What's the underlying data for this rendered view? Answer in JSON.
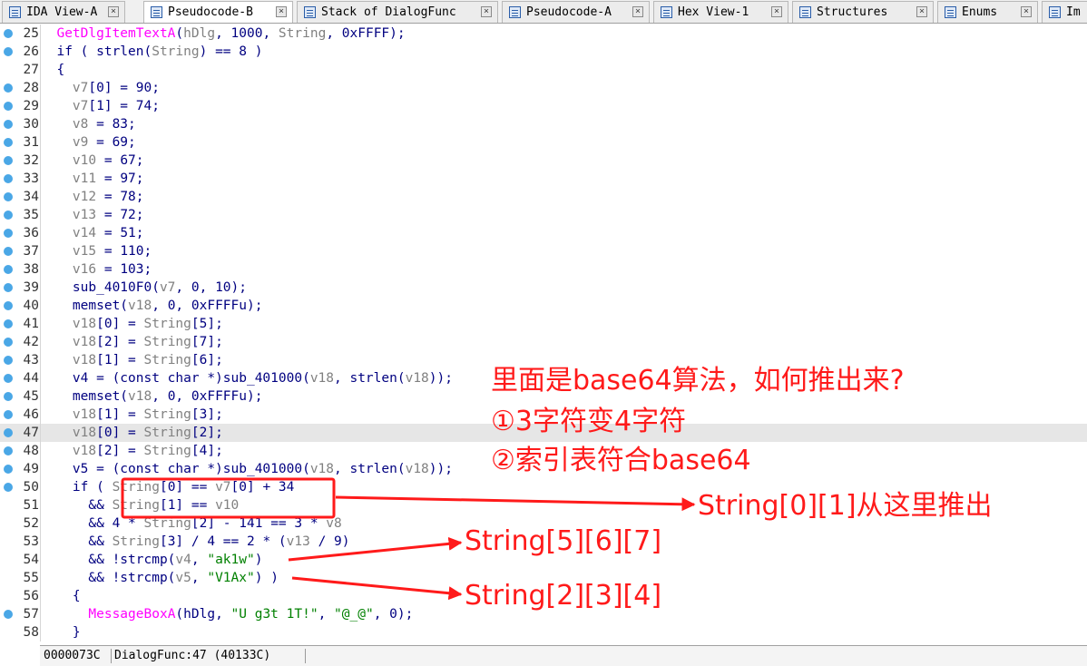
{
  "tabs": [
    {
      "label": "IDA View-A",
      "close": "×",
      "icon": "ida-view-icon",
      "active": false
    },
    {
      "label": "Pseudocode-B",
      "close": "×",
      "icon": "pseudocode-icon",
      "active": true
    },
    {
      "label": "Stack of DialogFunc",
      "close": "×",
      "icon": "stack-icon",
      "active": false
    },
    {
      "label": "Pseudocode-A",
      "close": "×",
      "icon": "pseudocode-icon",
      "active": false
    },
    {
      "label": "Hex View-1",
      "close": "×",
      "icon": "hex-view-icon",
      "active": false
    },
    {
      "label": "Structures",
      "close": "×",
      "icon": "structures-icon",
      "active": false
    },
    {
      "label": "Enums",
      "close": "×",
      "icon": "enums-icon",
      "active": false
    },
    {
      "label": "Im",
      "close": "",
      "icon": "imports-icon",
      "active": false
    }
  ],
  "code_lines": [
    {
      "num": "25",
      "bp": true,
      "segs": [
        {
          "c": "  "
        },
        {
          "c": "GetDlgItemTextA",
          "t": "fn"
        },
        {
          "c": "("
        },
        {
          "c": "hDlg",
          "t": "var"
        },
        {
          "c": ", 1000, "
        },
        {
          "c": "String",
          "t": "var"
        },
        {
          "c": ", 0xFFFF);"
        }
      ]
    },
    {
      "num": "26",
      "bp": true,
      "segs": [
        {
          "c": "  if ( strlen("
        },
        {
          "c": "String",
          "t": "var"
        },
        {
          "c": ") == 8 )"
        }
      ]
    },
    {
      "num": "27",
      "bp": false,
      "segs": [
        {
          "c": "  {"
        }
      ]
    },
    {
      "num": "28",
      "bp": true,
      "segs": [
        {
          "c": "    "
        },
        {
          "c": "v7",
          "t": "var"
        },
        {
          "c": "[0] = 90;"
        }
      ]
    },
    {
      "num": "29",
      "bp": true,
      "segs": [
        {
          "c": "    "
        },
        {
          "c": "v7",
          "t": "var"
        },
        {
          "c": "[1] = 74;"
        }
      ]
    },
    {
      "num": "30",
      "bp": true,
      "segs": [
        {
          "c": "    "
        },
        {
          "c": "v8",
          "t": "var"
        },
        {
          "c": " = 83;"
        }
      ]
    },
    {
      "num": "31",
      "bp": true,
      "segs": [
        {
          "c": "    "
        },
        {
          "c": "v9",
          "t": "var"
        },
        {
          "c": " = 69;"
        }
      ]
    },
    {
      "num": "32",
      "bp": true,
      "segs": [
        {
          "c": "    "
        },
        {
          "c": "v10",
          "t": "var"
        },
        {
          "c": " = 67;"
        }
      ]
    },
    {
      "num": "33",
      "bp": true,
      "segs": [
        {
          "c": "    "
        },
        {
          "c": "v11",
          "t": "var"
        },
        {
          "c": " = 97;"
        }
      ]
    },
    {
      "num": "34",
      "bp": true,
      "segs": [
        {
          "c": "    "
        },
        {
          "c": "v12",
          "t": "var"
        },
        {
          "c": " = 78;"
        }
      ]
    },
    {
      "num": "35",
      "bp": true,
      "segs": [
        {
          "c": "    "
        },
        {
          "c": "v13",
          "t": "var"
        },
        {
          "c": " = 72;"
        }
      ]
    },
    {
      "num": "36",
      "bp": true,
      "segs": [
        {
          "c": "    "
        },
        {
          "c": "v14",
          "t": "var"
        },
        {
          "c": " = 51;"
        }
      ]
    },
    {
      "num": "37",
      "bp": true,
      "segs": [
        {
          "c": "    "
        },
        {
          "c": "v15",
          "t": "var"
        },
        {
          "c": " = 110;"
        }
      ]
    },
    {
      "num": "38",
      "bp": true,
      "segs": [
        {
          "c": "    "
        },
        {
          "c": "v16",
          "t": "var"
        },
        {
          "c": " = 103;"
        }
      ]
    },
    {
      "num": "39",
      "bp": true,
      "segs": [
        {
          "c": "    sub_4010F0("
        },
        {
          "c": "v7",
          "t": "var"
        },
        {
          "c": ", 0, 10);"
        }
      ]
    },
    {
      "num": "40",
      "bp": true,
      "segs": [
        {
          "c": "    memset("
        },
        {
          "c": "v18",
          "t": "var"
        },
        {
          "c": ", 0, 0xFFFFu);"
        }
      ]
    },
    {
      "num": "41",
      "bp": true,
      "segs": [
        {
          "c": "    "
        },
        {
          "c": "v18",
          "t": "var"
        },
        {
          "c": "[0] = "
        },
        {
          "c": "String",
          "t": "var"
        },
        {
          "c": "[5];"
        }
      ]
    },
    {
      "num": "42",
      "bp": true,
      "segs": [
        {
          "c": "    "
        },
        {
          "c": "v18",
          "t": "var"
        },
        {
          "c": "[2] = "
        },
        {
          "c": "String",
          "t": "var"
        },
        {
          "c": "[7];"
        }
      ]
    },
    {
      "num": "43",
      "bp": true,
      "segs": [
        {
          "c": "    "
        },
        {
          "c": "v18",
          "t": "var"
        },
        {
          "c": "[1] = "
        },
        {
          "c": "String",
          "t": "var"
        },
        {
          "c": "[6];"
        }
      ]
    },
    {
      "num": "44",
      "bp": true,
      "segs": [
        {
          "c": "    v4 = (const char *)sub_401000("
        },
        {
          "c": "v18",
          "t": "var"
        },
        {
          "c": ", strlen("
        },
        {
          "c": "v18",
          "t": "var"
        },
        {
          "c": "));"
        }
      ]
    },
    {
      "num": "45",
      "bp": true,
      "segs": [
        {
          "c": "    memset("
        },
        {
          "c": "v18",
          "t": "var"
        },
        {
          "c": ", 0, 0xFFFFu);"
        }
      ]
    },
    {
      "num": "46",
      "bp": true,
      "segs": [
        {
          "c": "    "
        },
        {
          "c": "v18",
          "t": "var"
        },
        {
          "c": "[1] = "
        },
        {
          "c": "String",
          "t": "var"
        },
        {
          "c": "[3];"
        }
      ]
    },
    {
      "num": "47",
      "bp": true,
      "hl": true,
      "segs": [
        {
          "c": "    "
        },
        {
          "c": "v18",
          "t": "var"
        },
        {
          "c": "[0] = "
        },
        {
          "c": "String",
          "t": "var"
        },
        {
          "c": "[2];"
        }
      ]
    },
    {
      "num": "48",
      "bp": true,
      "segs": [
        {
          "c": "    "
        },
        {
          "c": "v18",
          "t": "var"
        },
        {
          "c": "[2] = "
        },
        {
          "c": "String",
          "t": "var"
        },
        {
          "c": "[4];"
        }
      ]
    },
    {
      "num": "49",
      "bp": true,
      "segs": [
        {
          "c": "    v5 = (const char *)sub_401000("
        },
        {
          "c": "v18",
          "t": "var"
        },
        {
          "c": ", strlen("
        },
        {
          "c": "v18",
          "t": "var"
        },
        {
          "c": "));"
        }
      ]
    },
    {
      "num": "50",
      "bp": true,
      "segs": [
        {
          "c": "    if ( "
        },
        {
          "c": "String",
          "t": "var"
        },
        {
          "c": "[0] == "
        },
        {
          "c": "v7",
          "t": "var"
        },
        {
          "c": "[0] + 34"
        }
      ]
    },
    {
      "num": "51",
      "bp": false,
      "segs": [
        {
          "c": "      && "
        },
        {
          "c": "String",
          "t": "var"
        },
        {
          "c": "[1] == "
        },
        {
          "c": "v10",
          "t": "var"
        }
      ]
    },
    {
      "num": "52",
      "bp": false,
      "segs": [
        {
          "c": "      && 4 * "
        },
        {
          "c": "String",
          "t": "var"
        },
        {
          "c": "[2] - 141 == 3 * "
        },
        {
          "c": "v8",
          "t": "var"
        }
      ]
    },
    {
      "num": "53",
      "bp": false,
      "segs": [
        {
          "c": "      && "
        },
        {
          "c": "String",
          "t": "var"
        },
        {
          "c": "[3] / 4 == 2 * ("
        },
        {
          "c": "v13",
          "t": "var"
        },
        {
          "c": " / 9)"
        }
      ]
    },
    {
      "num": "54",
      "bp": false,
      "segs": [
        {
          "c": "      && !strcmp("
        },
        {
          "c": "v4",
          "t": "var"
        },
        {
          "c": ", "
        },
        {
          "c": "\"ak1w\"",
          "t": "str"
        },
        {
          "c": ")"
        }
      ]
    },
    {
      "num": "55",
      "bp": false,
      "segs": [
        {
          "c": "      && !strcmp("
        },
        {
          "c": "v5",
          "t": "var"
        },
        {
          "c": ", "
        },
        {
          "c": "\"V1Ax\"",
          "t": "str"
        },
        {
          "c": ") )"
        }
      ]
    },
    {
      "num": "56",
      "bp": false,
      "segs": [
        {
          "c": "    {"
        }
      ]
    },
    {
      "num": "57",
      "bp": true,
      "segs": [
        {
          "c": "      "
        },
        {
          "c": "MessageBoxA",
          "t": "fn"
        },
        {
          "c": "(hDlg, "
        },
        {
          "c": "\"U g3t 1T!\"",
          "t": "str"
        },
        {
          "c": ", "
        },
        {
          "c": "\"@_@\"",
          "t": "str"
        },
        {
          "c": ", 0);"
        }
      ]
    },
    {
      "num": "58",
      "bp": false,
      "segs": [
        {
          "c": "    }"
        }
      ]
    }
  ],
  "status": {
    "address": "0000073C",
    "function": "DialogFunc:47 (40133C)"
  },
  "annotations": {
    "line1": "里面是base64算法，如何推出来?",
    "line2": "①3字符变4字符",
    "line3": "②索引表符合base64",
    "arrow1": "String[0][1]从这里推出",
    "arrow2": "String[5][6][7]",
    "arrow3": "String[2][3][4]",
    "color": "#ff1a1a"
  }
}
